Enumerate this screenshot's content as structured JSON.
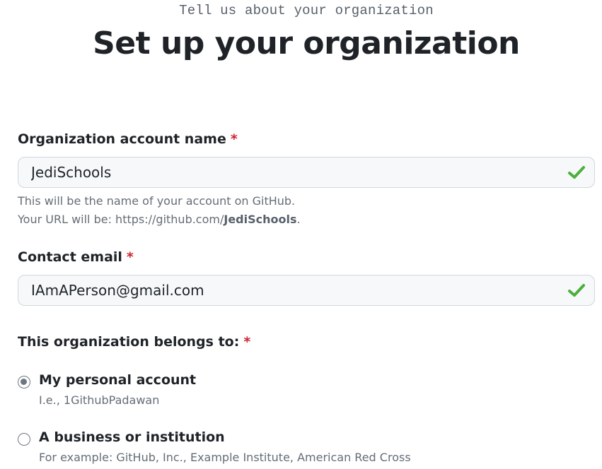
{
  "header": {
    "eyebrow": "Tell us about your organization",
    "title": "Set up your organization"
  },
  "form": {
    "required_marker": "*",
    "org_name": {
      "label": "Organization account name",
      "value": "JediSchools",
      "valid_icon": "check-icon",
      "hint_line1": "This will be the name of your account on GitHub.",
      "hint_line2_prefix": "Your URL will be: https://github.com/",
      "hint_line2_name": "JediSchools",
      "hint_line2_suffix": "."
    },
    "email": {
      "label": "Contact email",
      "value": "IAmAPerson@gmail.com",
      "valid_icon": "check-icon"
    },
    "belongs_to": {
      "label": "This organization belongs to:",
      "options": [
        {
          "label": "My personal account",
          "description": "I.e., 1GithubPadawan",
          "checked": true
        },
        {
          "label": "A business or institution",
          "description": "For example: GitHub, Inc., Example Institute, American Red Cross",
          "checked": false
        }
      ]
    }
  },
  "colors": {
    "valid": "#4caf3d",
    "required": "#cf222e"
  }
}
